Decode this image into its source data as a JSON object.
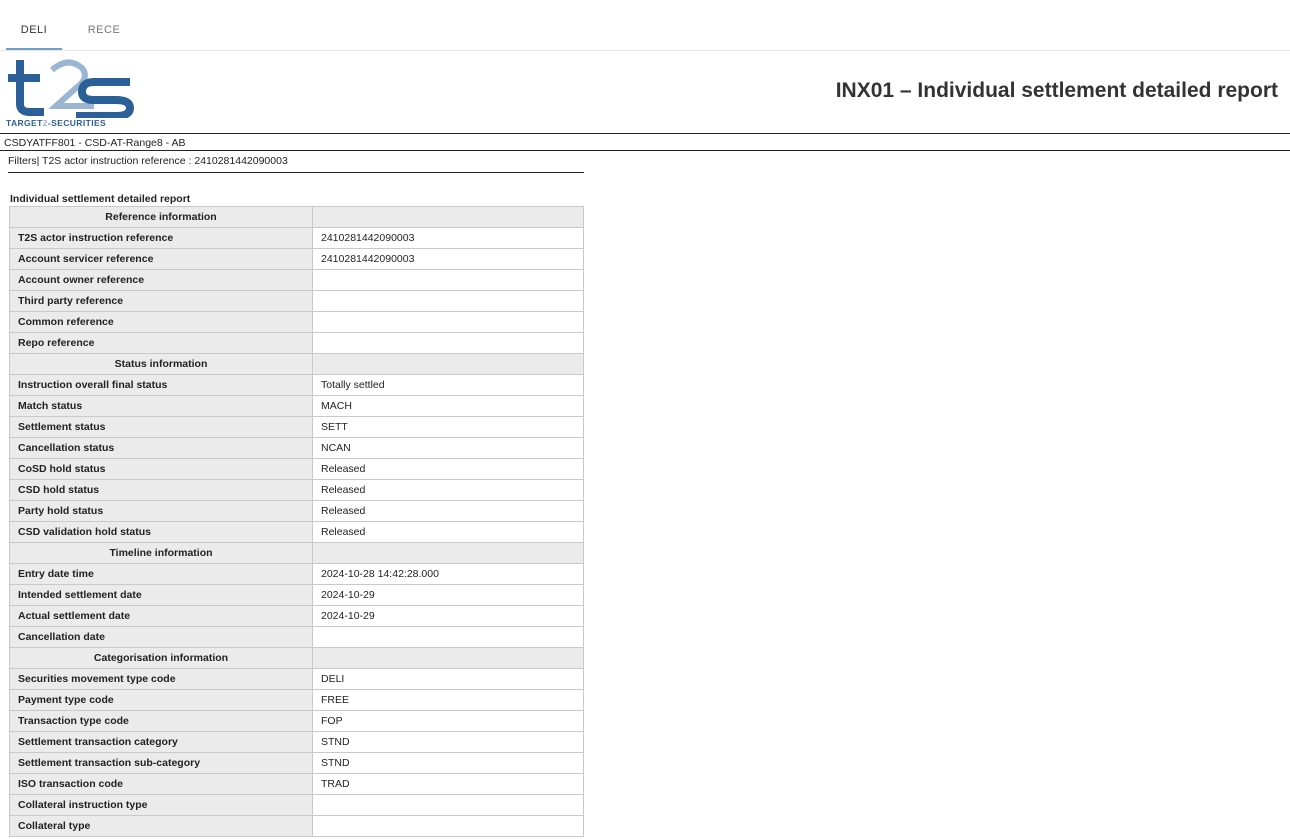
{
  "tabs": [
    {
      "label": "DELI",
      "active": true
    },
    {
      "label": "RECE",
      "active": false
    }
  ],
  "logo": {
    "tagline_left": "TARGET",
    "tagline_mid": "2",
    "tagline_right": "-SECURITIES"
  },
  "report_title": "INX01 – Individual settlement detailed report",
  "party_line": "CSDYATFF801 - CSD-AT-Range8 - AB",
  "filters_line": "Filters| T2S actor instruction reference : 2410281442090003",
  "section_title": "Individual settlement detailed report",
  "rows": [
    {
      "type": "header",
      "label": "Reference information",
      "value": ""
    },
    {
      "type": "field",
      "label": "T2S actor instruction reference",
      "value": "2410281442090003"
    },
    {
      "type": "field",
      "label": "Account servicer reference",
      "value": "2410281442090003"
    },
    {
      "type": "field",
      "label": "Account owner reference",
      "value": ""
    },
    {
      "type": "field",
      "label": "Third party reference",
      "value": ""
    },
    {
      "type": "field",
      "label": "Common reference",
      "value": ""
    },
    {
      "type": "field",
      "label": "Repo reference",
      "value": ""
    },
    {
      "type": "header",
      "label": "Status information",
      "value": ""
    },
    {
      "type": "field",
      "label": "Instruction overall final status",
      "value": "Totally settled"
    },
    {
      "type": "field",
      "label": "Match status",
      "value": "MACH"
    },
    {
      "type": "field",
      "label": "Settlement status",
      "value": "SETT"
    },
    {
      "type": "field",
      "label": "Cancellation status",
      "value": "NCAN"
    },
    {
      "type": "field",
      "label": "CoSD hold status",
      "value": "Released"
    },
    {
      "type": "field",
      "label": "CSD hold status",
      "value": "Released"
    },
    {
      "type": "field",
      "label": "Party hold status",
      "value": "Released"
    },
    {
      "type": "field",
      "label": "CSD validation hold status",
      "value": "Released"
    },
    {
      "type": "header",
      "label": "Timeline information",
      "value": ""
    },
    {
      "type": "field",
      "label": "Entry date time",
      "value": "2024-10-28 14:42:28.000"
    },
    {
      "type": "field",
      "label": "Intended settlement date",
      "value": "2024-10-29"
    },
    {
      "type": "field",
      "label": "Actual settlement date",
      "value": "2024-10-29"
    },
    {
      "type": "field",
      "label": "Cancellation date",
      "value": ""
    },
    {
      "type": "header",
      "label": "Categorisation information",
      "value": ""
    },
    {
      "type": "field",
      "label": "Securities movement type code",
      "value": "DELI"
    },
    {
      "type": "field",
      "label": "Payment type code",
      "value": "FREE"
    },
    {
      "type": "field",
      "label": "Transaction type code",
      "value": "FOP"
    },
    {
      "type": "field",
      "label": "Settlement transaction category",
      "value": "STND"
    },
    {
      "type": "field",
      "label": "Settlement transaction sub-category",
      "value": "STND"
    },
    {
      "type": "field",
      "label": "ISO transaction code",
      "value": "TRAD"
    },
    {
      "type": "field",
      "label": "Collateral instruction type",
      "value": ""
    },
    {
      "type": "field",
      "label": "Collateral type",
      "value": ""
    }
  ]
}
